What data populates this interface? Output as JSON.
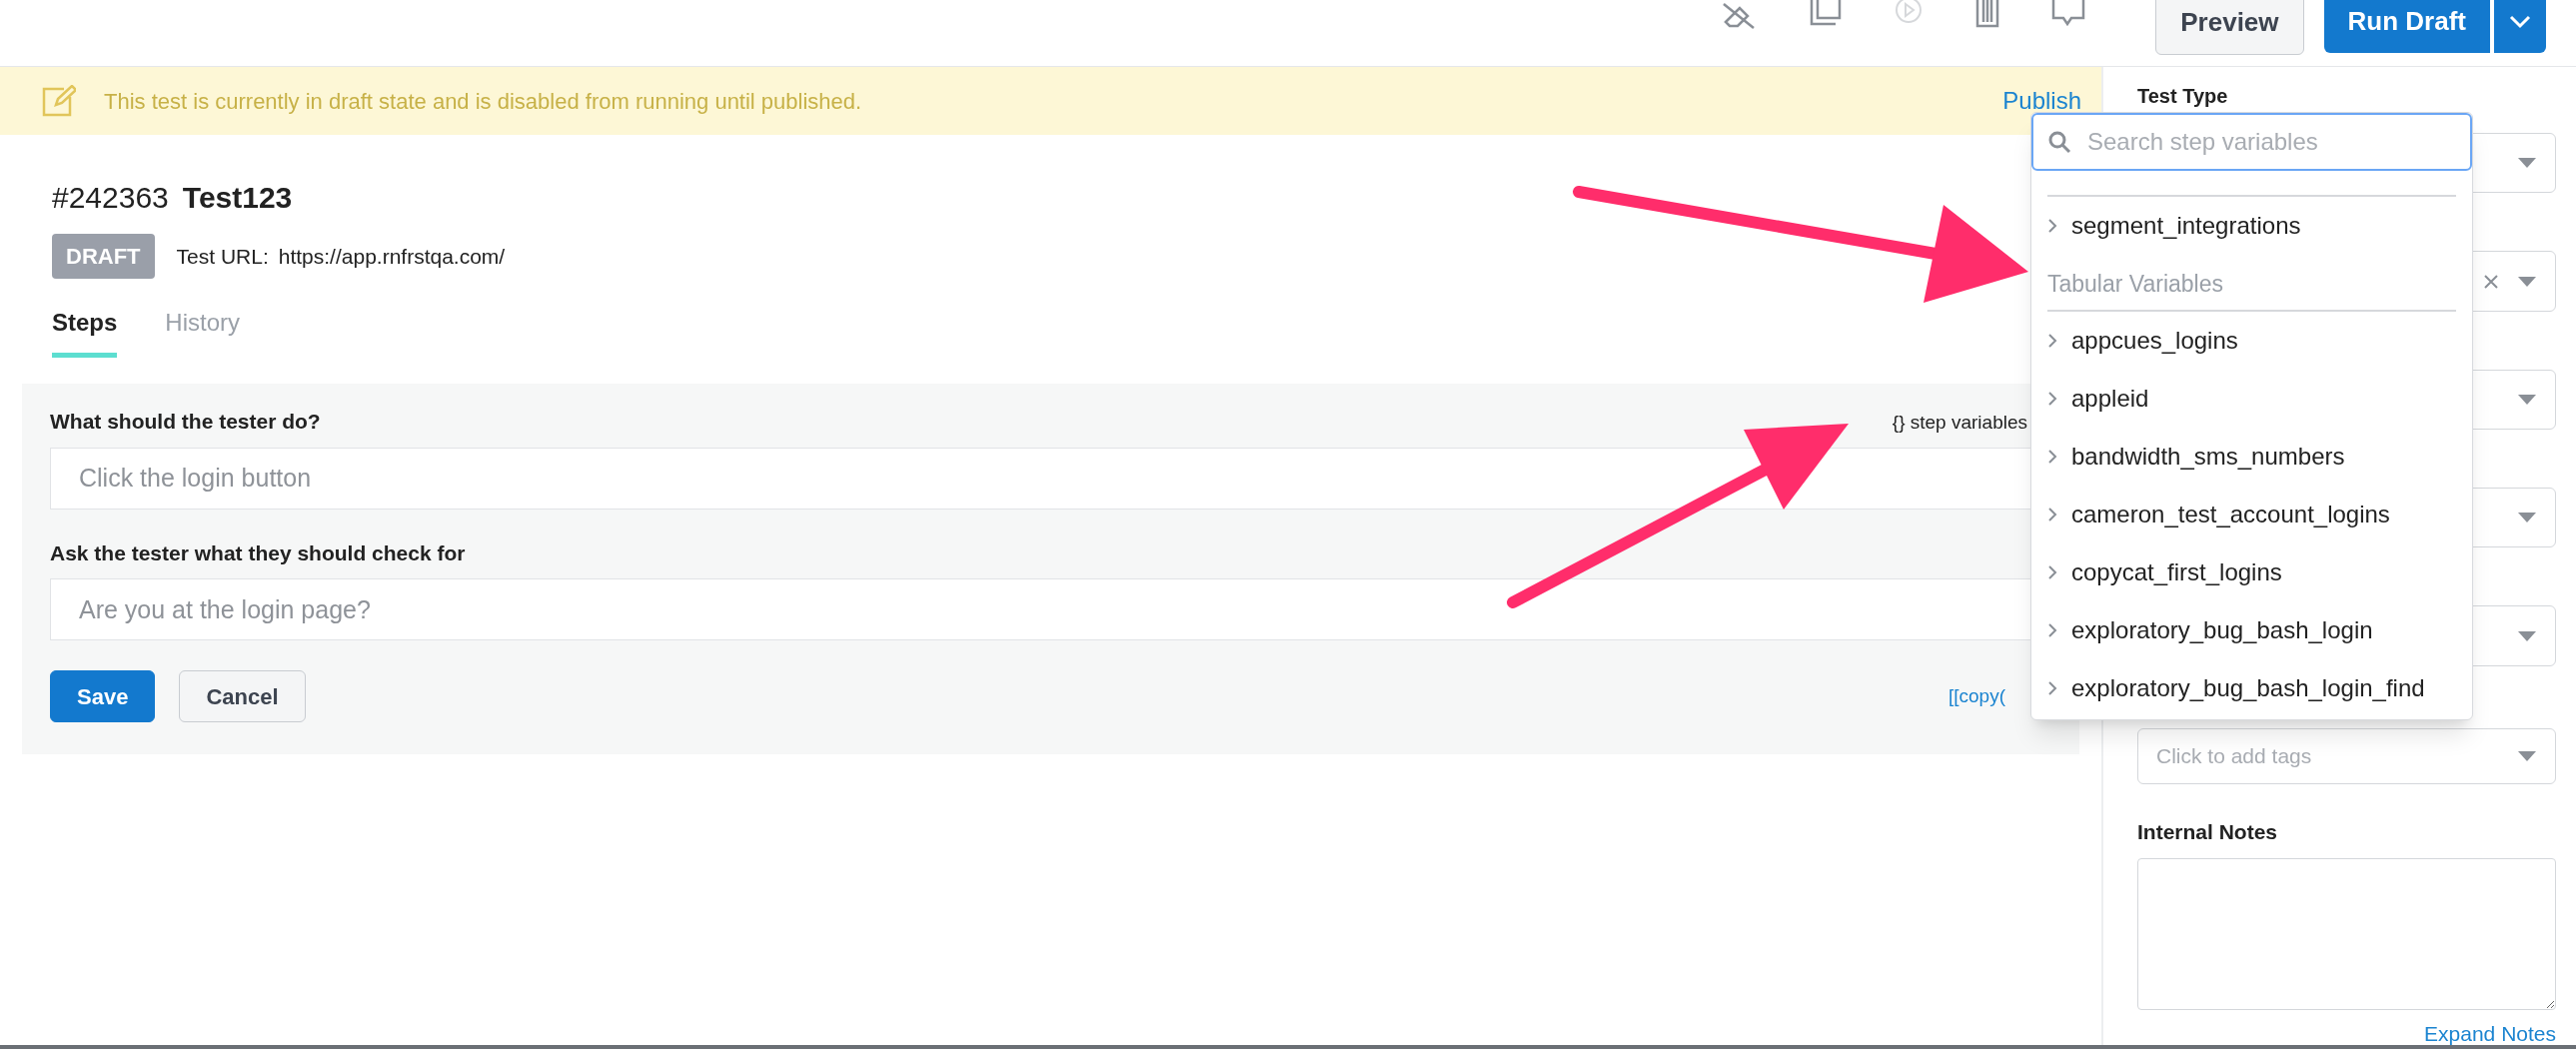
{
  "toolbar": {
    "buttons": [
      {
        "label": "Preview",
        "kind": "secondary"
      },
      {
        "label": "Run Draft",
        "kind": "primary"
      }
    ]
  },
  "banner": {
    "text": "This test is currently in draft state and is disabled from running until published.",
    "action": "Publish"
  },
  "test": {
    "id": "#242363",
    "name": "Test123",
    "status": "DRAFT",
    "url_label": "Test URL:",
    "url": "https://app.rnfrstqa.com/"
  },
  "tabs": [
    {
      "label": "Steps",
      "selected": true
    },
    {
      "label": "History",
      "selected": false
    }
  ],
  "step_form": {
    "variables_link": "{} step variables",
    "fields": [
      {
        "label": "What should the tester do?",
        "placeholder": "Click the login button"
      },
      {
        "label": "Ask the tester what they should check for",
        "placeholder": "Are you at the login page?"
      }
    ],
    "buttons": [
      {
        "label": "Save",
        "kind": "primary"
      },
      {
        "label": "Cancel",
        "kind": "secondary"
      }
    ],
    "copy_link": "[[copy("
  },
  "sidebar": {
    "first_label": "Test Type",
    "selects": [
      {
        "clearable": false
      },
      {
        "clearable": true
      },
      {
        "clearable": false
      },
      {
        "clearable": false
      },
      {
        "clearable": false
      }
    ],
    "tags": {
      "placeholder": "Click to add tags"
    },
    "notes": {
      "label": "Internal Notes",
      "link": "Expand Notes"
    }
  },
  "variables_dropdown": {
    "search": {
      "placeholder": "Search step variables"
    },
    "groups": [
      {
        "items": [
          "segment_integrations"
        ]
      },
      {
        "label": "Tabular Variables",
        "items": [
          "appcues_logins",
          "appleid",
          "bandwidth_sms_numbers",
          "cameron_test_account_logins",
          "copycat_first_logins",
          "exploratory_bug_bash_login",
          "exploratory_bug_bash_login_find"
        ]
      }
    ]
  }
}
